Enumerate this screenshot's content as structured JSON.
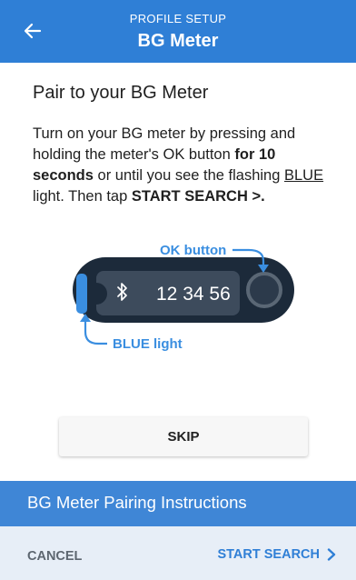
{
  "header": {
    "subtitle": "PROFILE SETUP",
    "title": "BG Meter"
  },
  "content": {
    "heading": "Pair to your BG Meter",
    "instruction_parts": {
      "p1": "Turn on your BG meter by pressing and holding the meter's OK button ",
      "b1": "for 10 seconds",
      "p2": " or until you see the flashing ",
      "u1": "BLUE",
      "p3": " light. Then tap ",
      "b2": "START SEARCH >."
    }
  },
  "illustration": {
    "ok_button_label": "OK button",
    "blue_light_label": "BLUE light",
    "meter_display": "12 34 56"
  },
  "buttons": {
    "skip": "SKIP"
  },
  "banner": {
    "text": "BG Meter Pairing Instructions"
  },
  "footer": {
    "cancel": "CANCEL",
    "start_search": "START SEARCH"
  },
  "colors": {
    "header": "#2f7fd6",
    "banner": "#3f86d6",
    "footer": "#e7eef7",
    "accent_blue": "#3a8ee0",
    "meter_body": "#1c2a3a"
  },
  "icons": {
    "back": "arrow-left-icon",
    "bluetooth": "bluetooth-icon",
    "start_chevron": "chevron-right-icon"
  }
}
